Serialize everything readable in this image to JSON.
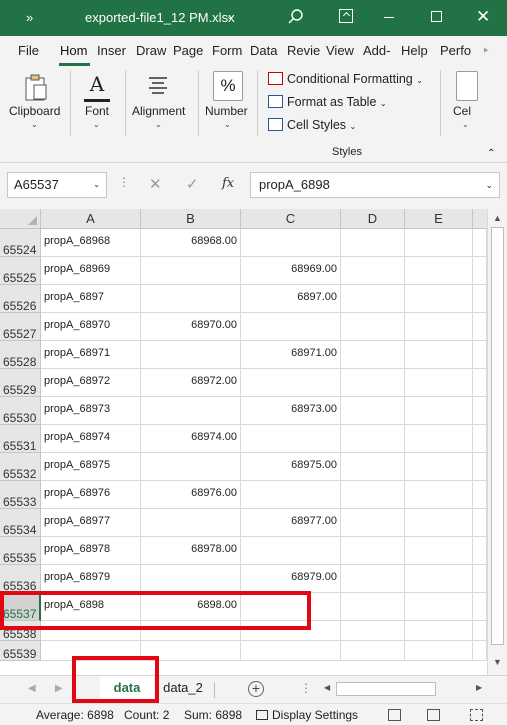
{
  "titlebar": {
    "expand_icon": "»",
    "filename": "exported-file1_12 PM.xlsx",
    "caret": "⌄",
    "close_glyph": "✕",
    "accent": "#217346"
  },
  "tabs": [
    "File",
    "Hom",
    "Inser",
    "Draw",
    "Page",
    "Form",
    "Data",
    "Revie",
    "View",
    "Add-",
    "Help",
    "Perfo"
  ],
  "tabs_more": "‣",
  "ribbon": {
    "clipboard_label": "Clipboard",
    "font_label": "Font",
    "alignment_label": "Alignment",
    "number_label": "Number",
    "number_icon": "%",
    "font_icon": "A",
    "conditional_formatting": "Conditional Formatting",
    "format_as_table": "Format as Table",
    "cell_styles": "Cell Styles",
    "styles_group": "Styles",
    "cells_label": "Cel",
    "caret": "⌄",
    "collapse_icon": "⌃"
  },
  "formula_bar": {
    "name_box": "A65537",
    "cancel_glyph": "✕",
    "enter_glyph": "✓",
    "fx_label": "fx",
    "content": "propA_6898"
  },
  "columns": [
    "A",
    "B",
    "C",
    "D",
    "E"
  ],
  "rows": [
    {
      "num": "65524",
      "a": "propA_68968",
      "b": "68968.00",
      "c": ""
    },
    {
      "num": "65525",
      "a": "propA_68969",
      "b": "",
      "c": "68969.00"
    },
    {
      "num": "65526",
      "a": "propA_6897",
      "b": "",
      "c": "6897.00"
    },
    {
      "num": "65527",
      "a": "propA_68970",
      "b": "68970.00",
      "c": ""
    },
    {
      "num": "65528",
      "a": "propA_68971",
      "b": "",
      "c": "68971.00"
    },
    {
      "num": "65529",
      "a": "propA_68972",
      "b": "68972.00",
      "c": ""
    },
    {
      "num": "65530",
      "a": "propA_68973",
      "b": "",
      "c": "68973.00"
    },
    {
      "num": "65531",
      "a": "propA_68974",
      "b": "68974.00",
      "c": ""
    },
    {
      "num": "65532",
      "a": "propA_68975",
      "b": "",
      "c": "68975.00"
    },
    {
      "num": "65533",
      "a": "propA_68976",
      "b": "68976.00",
      "c": ""
    },
    {
      "num": "65534",
      "a": "propA_68977",
      "b": "",
      "c": "68977.00"
    },
    {
      "num": "65535",
      "a": "propA_68978",
      "b": "68978.00",
      "c": ""
    },
    {
      "num": "65536",
      "a": "propA_68979",
      "b": "",
      "c": "68979.00"
    },
    {
      "num": "65537",
      "a": "propA_6898",
      "b": "6898.00",
      "c": "",
      "selected": true
    },
    {
      "num": "65538",
      "a": "",
      "b": "",
      "c": ""
    },
    {
      "num": "65539",
      "a": "",
      "b": "",
      "c": ""
    }
  ],
  "sheets": {
    "active": "data",
    "other": "data_2",
    "add_glyph": "+",
    "nav_prev": "◀",
    "nav_next": "▶"
  },
  "status": {
    "average": "Average: 6898",
    "count": "Count: 2",
    "sum": "Sum: 6898",
    "display_settings": "Display Settings"
  },
  "highlight_color": "#e30613"
}
